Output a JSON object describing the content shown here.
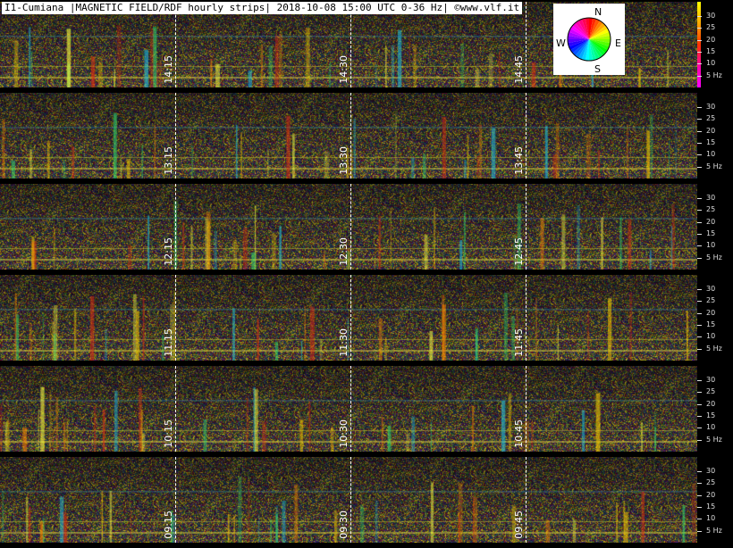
{
  "chart_data": {
    "type": "heatmap",
    "title": "I1-Cumiana |MAGNETIC FIELD/RDF hourly strips| 2018-10-08 15:00 UTC 0-36 Hz| ©www.vlf.it",
    "frequency_ticks": [
      "30",
      "25",
      "20",
      "15",
      "10",
      "5 Hz"
    ],
    "frequency_range_hz": [
      0,
      36
    ],
    "rows": [
      {
        "markers": [
          "14:15",
          "14:30",
          "14:45"
        ]
      },
      {
        "markers": [
          "13:15",
          "13:30",
          "13:45"
        ]
      },
      {
        "markers": [
          "12:15",
          "12:30",
          "12:45"
        ]
      },
      {
        "markers": [
          "11:15",
          "11:30",
          "11:45"
        ]
      },
      {
        "markers": [
          "10:15",
          "10:30",
          "10:45"
        ]
      },
      {
        "markers": [
          "09:15",
          "09:30",
          "09:45"
        ]
      }
    ],
    "direction_legend": {
      "north": "N",
      "south": "S",
      "east": "E",
      "west": "W"
    }
  }
}
